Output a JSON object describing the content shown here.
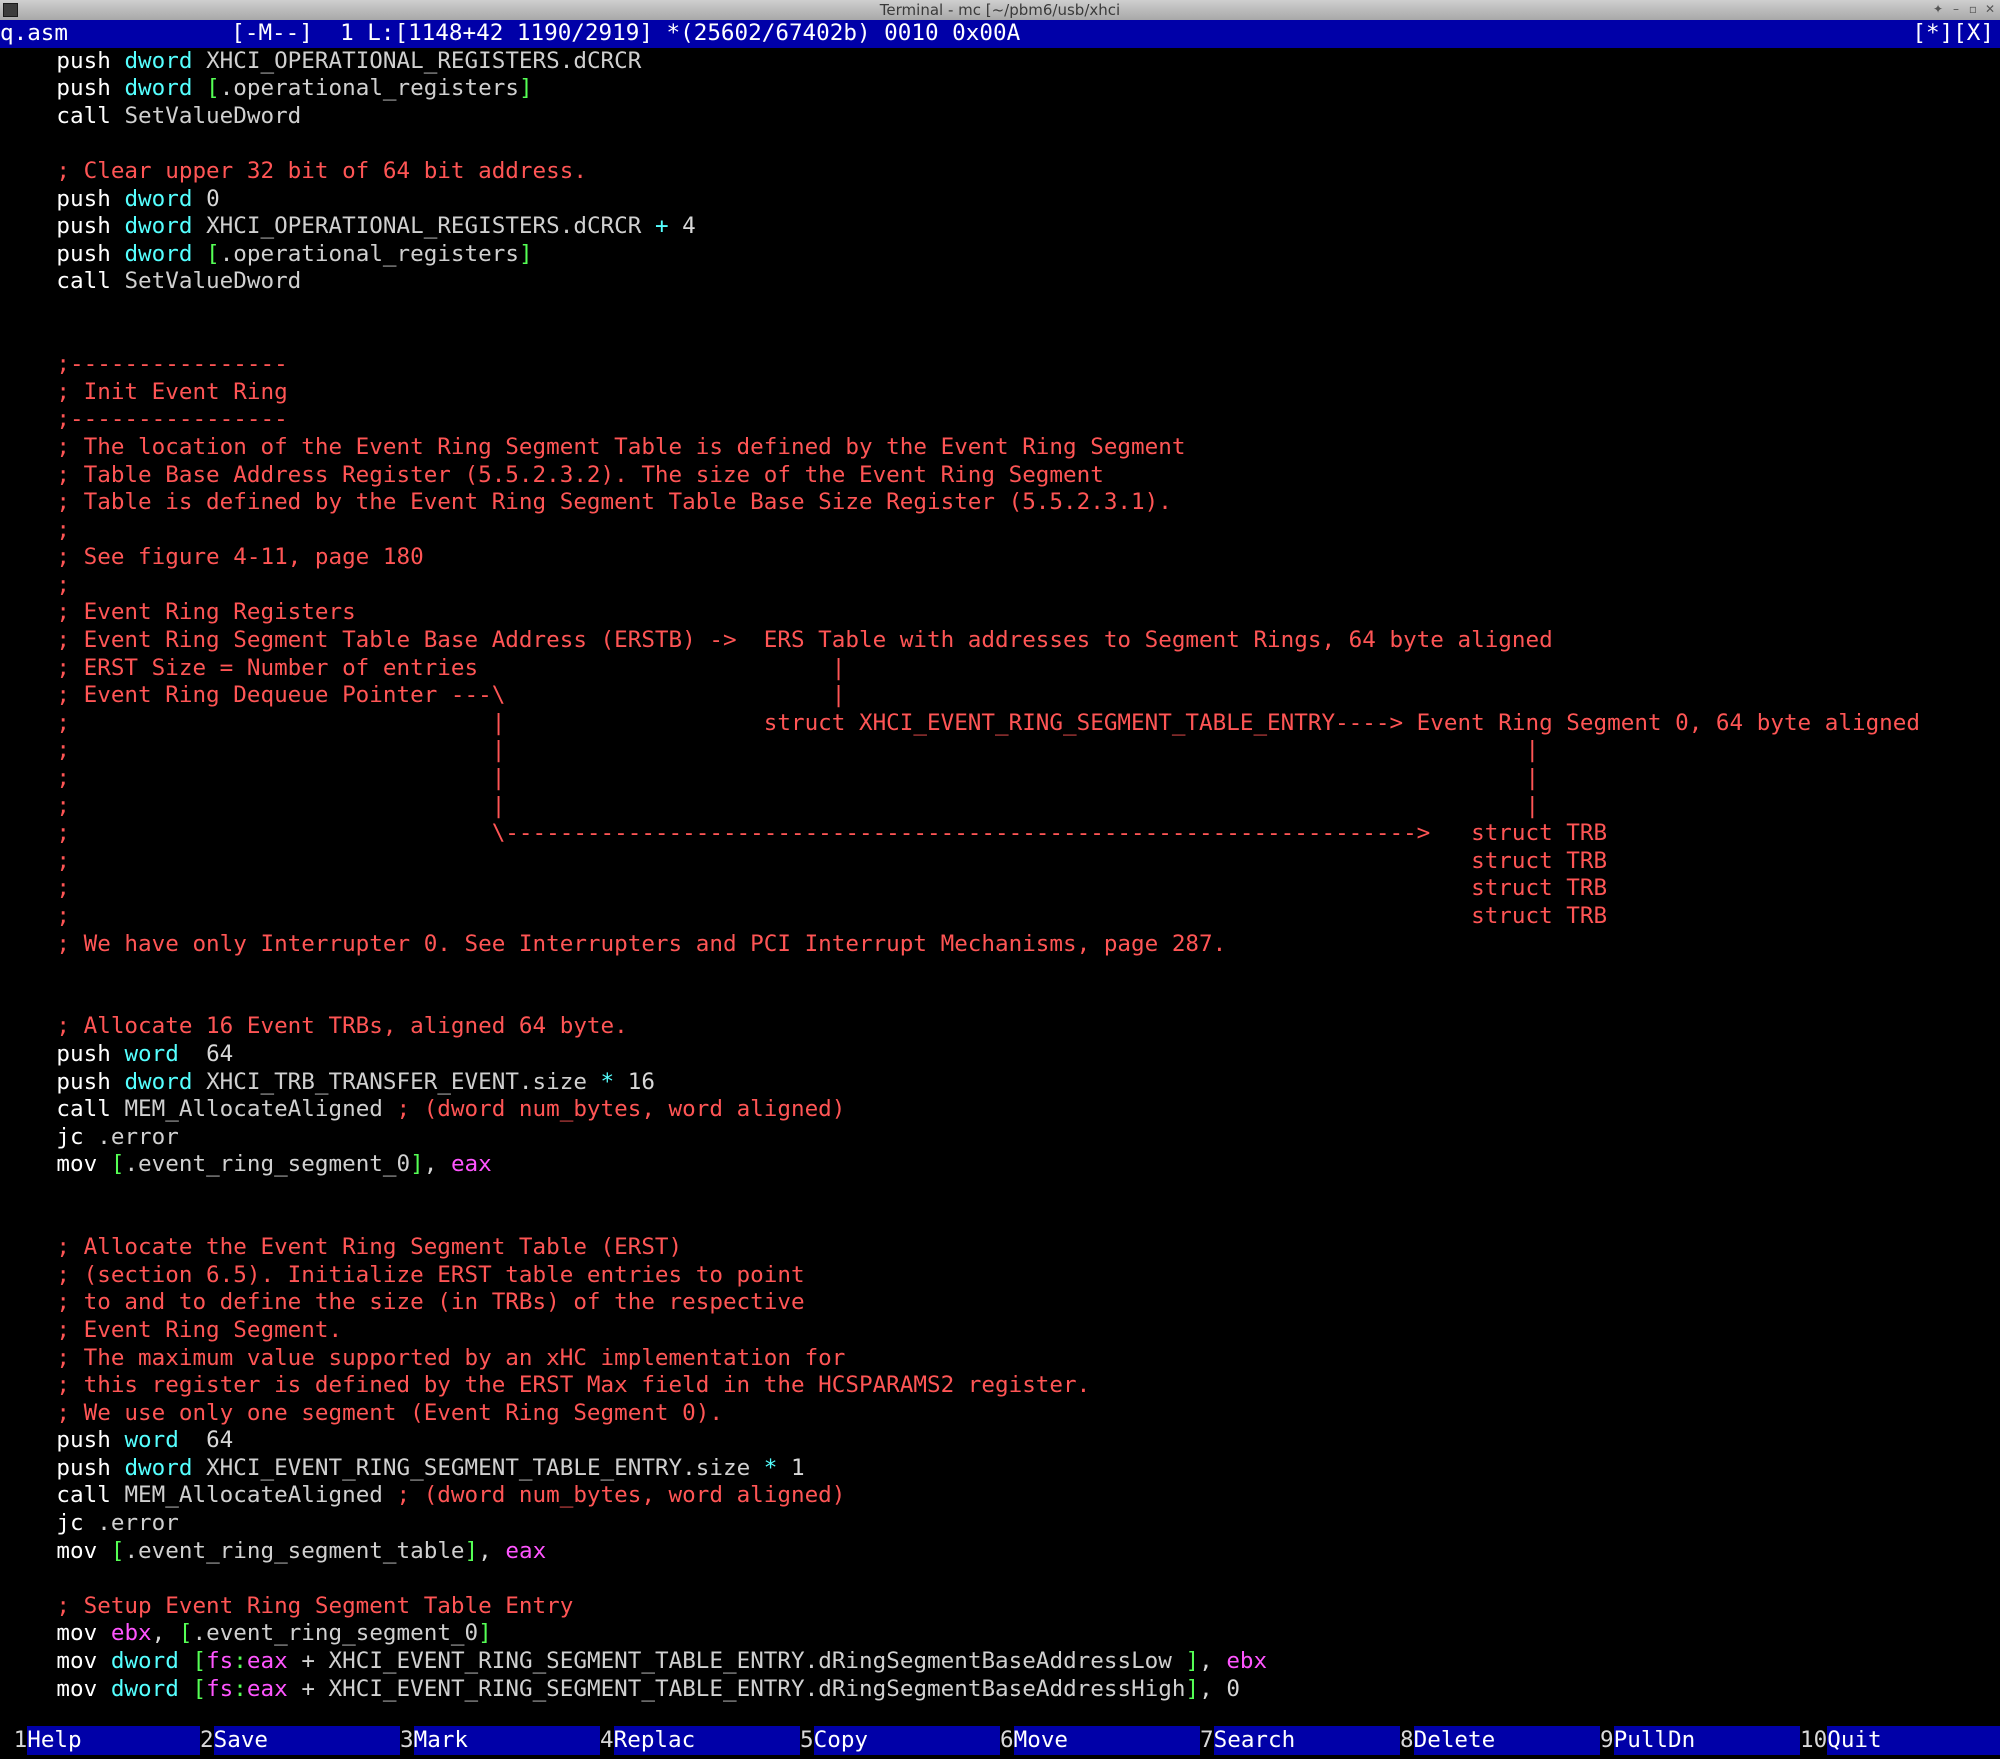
{
  "window": {
    "title": "Terminal - mc [~/pbm6/usb/xhci"
  },
  "status": {
    "left": "q.asm            [-M--]  1 L:[1148+42 1190/2919] *(25602/67402b) 0010 0x00A",
    "right": "[*][X]"
  },
  "editor": {
    "lines": [
      [
        [
          "    ",
          ""
        ],
        [
          "push",
          "kw"
        ],
        [
          " ",
          ""
        ],
        [
          "dword",
          "sz"
        ],
        [
          " XHCI_OPERATIONAL_REGISTERS.dCRCR",
          "id"
        ]
      ],
      [
        [
          "    ",
          ""
        ],
        [
          "push",
          "kw"
        ],
        [
          " ",
          ""
        ],
        [
          "dword",
          "sz"
        ],
        [
          " ",
          ""
        ],
        [
          "[",
          "br"
        ],
        [
          ".operational_registers",
          "id"
        ],
        [
          "]",
          "br"
        ]
      ],
      [
        [
          "    ",
          ""
        ],
        [
          "call",
          "kw"
        ],
        [
          " SetValueDword",
          "id"
        ]
      ],
      [],
      [
        [
          "    ",
          ""
        ],
        [
          "; Clear upper 32 bit of 64 bit address.",
          "cm"
        ]
      ],
      [
        [
          "    ",
          ""
        ],
        [
          "push",
          "kw"
        ],
        [
          " ",
          ""
        ],
        [
          "dword",
          "sz"
        ],
        [
          " 0",
          "num"
        ]
      ],
      [
        [
          "    ",
          ""
        ],
        [
          "push",
          "kw"
        ],
        [
          " ",
          ""
        ],
        [
          "dword",
          "sz"
        ],
        [
          " XHCI_OPERATIONAL_REGISTERS.dCRCR ",
          "id"
        ],
        [
          "+",
          "op"
        ],
        [
          " 4",
          "num"
        ]
      ],
      [
        [
          "    ",
          ""
        ],
        [
          "push",
          "kw"
        ],
        [
          " ",
          ""
        ],
        [
          "dword",
          "sz"
        ],
        [
          " ",
          ""
        ],
        [
          "[",
          "br"
        ],
        [
          ".operational_registers",
          "id"
        ],
        [
          "]",
          "br"
        ]
      ],
      [
        [
          "    ",
          ""
        ],
        [
          "call",
          "kw"
        ],
        [
          " SetValueDword",
          "id"
        ]
      ],
      [],
      [],
      [
        [
          "    ",
          ""
        ],
        [
          ";----------------",
          "cm"
        ]
      ],
      [
        [
          "    ",
          ""
        ],
        [
          "; Init Event Ring",
          "cm"
        ]
      ],
      [
        [
          "    ",
          ""
        ],
        [
          ";----------------",
          "cm"
        ]
      ],
      [
        [
          "    ",
          ""
        ],
        [
          "; The location of the Event Ring Segment Table is defined by the Event Ring Segment",
          "cm"
        ]
      ],
      [
        [
          "    ",
          ""
        ],
        [
          "; Table Base Address Register (5.5.2.3.2). The size of the Event Ring Segment",
          "cm"
        ]
      ],
      [
        [
          "    ",
          ""
        ],
        [
          "; Table is defined by the Event Ring Segment Table Base Size Register (5.5.2.3.1).",
          "cm"
        ]
      ],
      [
        [
          "    ",
          ""
        ],
        [
          ";",
          "cm"
        ]
      ],
      [
        [
          "    ",
          ""
        ],
        [
          "; See figure 4-11, page 180",
          "cm"
        ]
      ],
      [
        [
          "    ",
          ""
        ],
        [
          ";",
          "cm"
        ]
      ],
      [
        [
          "    ",
          ""
        ],
        [
          "; Event Ring Registers",
          "cm"
        ]
      ],
      [
        [
          "    ",
          ""
        ],
        [
          "; Event Ring Segment Table Base Address (ERSTB) ->  ERS Table with addresses to Segment Rings, 64 byte aligned",
          "cm"
        ]
      ],
      [
        [
          "    ",
          ""
        ],
        [
          "; ERST Size = Number of entries                          |",
          "cm"
        ]
      ],
      [
        [
          "    ",
          ""
        ],
        [
          "; Event Ring Dequeue Pointer ---\\                        |",
          "cm"
        ]
      ],
      [
        [
          "    ",
          ""
        ],
        [
          ";                               |                   struct XHCI_EVENT_RING_SEGMENT_TABLE_ENTRY----> Event Ring Segment 0, 64 byte aligned",
          "cm"
        ]
      ],
      [
        [
          "    ",
          ""
        ],
        [
          ";                               |                                                                           |",
          "cm"
        ]
      ],
      [
        [
          "    ",
          ""
        ],
        [
          ";                               |                                                                           |",
          "cm"
        ]
      ],
      [
        [
          "    ",
          ""
        ],
        [
          ";                               |                                                                           |",
          "cm"
        ]
      ],
      [
        [
          "    ",
          ""
        ],
        [
          ";                               \\------------------------------------------------------------------->   struct TRB",
          "cm"
        ]
      ],
      [
        [
          "    ",
          ""
        ],
        [
          ";                                                                                                       struct TRB",
          "cm"
        ]
      ],
      [
        [
          "    ",
          ""
        ],
        [
          ";                                                                                                       struct TRB",
          "cm"
        ]
      ],
      [
        [
          "    ",
          ""
        ],
        [
          ";                                                                                                       struct TRB",
          "cm"
        ]
      ],
      [
        [
          "    ",
          ""
        ],
        [
          "; We have only Interrupter 0. See Interrupters and PCI Interrupt Mechanisms, page 287.",
          "cm"
        ]
      ],
      [],
      [],
      [
        [
          "    ",
          ""
        ],
        [
          "; Allocate 16 Event TRBs, aligned 64 byte.",
          "cm"
        ]
      ],
      [
        [
          "    ",
          ""
        ],
        [
          "push",
          "kw"
        ],
        [
          " ",
          ""
        ],
        [
          "word",
          "sz"
        ],
        [
          "  64",
          "num"
        ]
      ],
      [
        [
          "    ",
          ""
        ],
        [
          "push",
          "kw"
        ],
        [
          " ",
          ""
        ],
        [
          "dword",
          "sz"
        ],
        [
          " XHCI_TRB_TRANSFER_EVENT.size ",
          "id"
        ],
        [
          "*",
          "op"
        ],
        [
          " 16",
          "num"
        ]
      ],
      [
        [
          "    ",
          ""
        ],
        [
          "call",
          "kw"
        ],
        [
          " MEM_AllocateAligned ",
          "id"
        ],
        [
          "; (dword num_bytes, word aligned)",
          "cm"
        ]
      ],
      [
        [
          "    ",
          ""
        ],
        [
          "jc",
          "kw"
        ],
        [
          " .error",
          "id"
        ]
      ],
      [
        [
          "    ",
          ""
        ],
        [
          "mov",
          "kw"
        ],
        [
          " ",
          ""
        ],
        [
          "[",
          "br"
        ],
        [
          ".event_ring_segment_0",
          "id"
        ],
        [
          "]",
          "br"
        ],
        [
          ", ",
          ""
        ],
        [
          "eax",
          "reg"
        ]
      ],
      [],
      [],
      [
        [
          "    ",
          ""
        ],
        [
          "; Allocate the Event Ring Segment Table (ERST)",
          "cm"
        ]
      ],
      [
        [
          "    ",
          ""
        ],
        [
          "; (section 6.5). Initialize ERST table entries to point",
          "cm"
        ]
      ],
      [
        [
          "    ",
          ""
        ],
        [
          "; to and to define the size (in TRBs) of the respective",
          "cm"
        ]
      ],
      [
        [
          "    ",
          ""
        ],
        [
          "; Event Ring Segment.",
          "cm"
        ]
      ],
      [
        [
          "    ",
          ""
        ],
        [
          "; The maximum value supported by an xHC implementation for",
          "cm"
        ]
      ],
      [
        [
          "    ",
          ""
        ],
        [
          "; this register is defined by the ERST Max field in the HCSPARAMS2 register.",
          "cm"
        ]
      ],
      [
        [
          "    ",
          ""
        ],
        [
          "; We use only one segment (Event Ring Segment 0).",
          "cm"
        ]
      ],
      [
        [
          "    ",
          ""
        ],
        [
          "push",
          "kw"
        ],
        [
          " ",
          ""
        ],
        [
          "word",
          "sz"
        ],
        [
          "  64",
          "num"
        ]
      ],
      [
        [
          "    ",
          ""
        ],
        [
          "push",
          "kw"
        ],
        [
          " ",
          ""
        ],
        [
          "dword",
          "sz"
        ],
        [
          " XHCI_EVENT_RING_SEGMENT_TABLE_ENTRY.size ",
          "id"
        ],
        [
          "*",
          "op"
        ],
        [
          " 1",
          "num"
        ]
      ],
      [
        [
          "    ",
          ""
        ],
        [
          "call",
          "kw"
        ],
        [
          " MEM_AllocateAligned ",
          "id"
        ],
        [
          "; (dword num_bytes, word aligned)",
          "cm"
        ]
      ],
      [
        [
          "    ",
          ""
        ],
        [
          "jc",
          "kw"
        ],
        [
          " .error",
          "id"
        ]
      ],
      [
        [
          "    ",
          ""
        ],
        [
          "mov",
          "kw"
        ],
        [
          " ",
          ""
        ],
        [
          "[",
          "br"
        ],
        [
          ".event_ring_segment_table",
          "id"
        ],
        [
          "]",
          "br"
        ],
        [
          ", ",
          ""
        ],
        [
          "eax",
          "reg"
        ]
      ],
      [],
      [
        [
          "    ",
          ""
        ],
        [
          "; Setup Event Ring Segment Table Entry",
          "cm"
        ]
      ],
      [
        [
          "    ",
          ""
        ],
        [
          "mov",
          "kw"
        ],
        [
          " ",
          ""
        ],
        [
          "ebx",
          "reg"
        ],
        [
          ", ",
          ""
        ],
        [
          "[",
          "br"
        ],
        [
          ".event_ring_segment_0",
          "id"
        ],
        [
          "]",
          "br"
        ]
      ],
      [
        [
          "    ",
          ""
        ],
        [
          "mov",
          "kw"
        ],
        [
          " ",
          ""
        ],
        [
          "dword",
          "sz"
        ],
        [
          " ",
          ""
        ],
        [
          "[",
          "br"
        ],
        [
          "fs",
          "reg"
        ],
        [
          ":",
          "br"
        ],
        [
          "eax",
          "reg"
        ],
        [
          " + XHCI_EVENT_RING_SEGMENT_TABLE_ENTRY.dRingSegmentBaseAddressLow ",
          "id"
        ],
        [
          "]",
          "br"
        ],
        [
          ", ",
          ""
        ],
        [
          "ebx",
          "reg"
        ]
      ],
      [
        [
          "    ",
          ""
        ],
        [
          "mov",
          "kw"
        ],
        [
          " ",
          ""
        ],
        [
          "dword",
          "sz"
        ],
        [
          " ",
          ""
        ],
        [
          "[",
          "br"
        ],
        [
          "fs",
          "reg"
        ],
        [
          ":",
          "br"
        ],
        [
          "eax",
          "reg"
        ],
        [
          " + XHCI_EVENT_RING_SEGMENT_TABLE_ENTRY.dRingSegmentBaseAddressHigh",
          "id"
        ],
        [
          "]",
          "br"
        ],
        [
          ", 0",
          ""
        ]
      ]
    ]
  },
  "keybar": [
    {
      "num": " 1",
      "label": "Help"
    },
    {
      "num": "2",
      "label": "Save"
    },
    {
      "num": "3",
      "label": "Mark"
    },
    {
      "num": "4",
      "label": "Replac"
    },
    {
      "num": "5",
      "label": "Copy"
    },
    {
      "num": "6",
      "label": "Move"
    },
    {
      "num": "7",
      "label": "Search"
    },
    {
      "num": "8",
      "label": "Delete"
    },
    {
      "num": "9",
      "label": "PullDn"
    },
    {
      "num": "10",
      "label": "Quit"
    }
  ]
}
